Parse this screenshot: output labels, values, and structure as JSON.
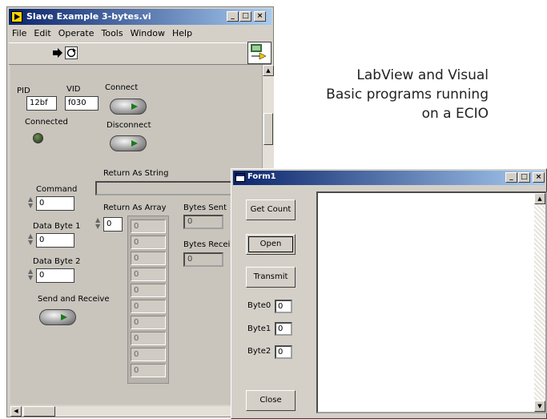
{
  "caption": {
    "line1": "LabView and Visual",
    "line2": "Basic programs running",
    "line3": "on a ECIO"
  },
  "labview": {
    "title": "Slave Example 3-bytes.vi",
    "window_buttons": [
      "_",
      "□",
      "×"
    ],
    "menu": [
      "File",
      "Edit",
      "Operate",
      "Tools",
      "Window",
      "Help"
    ],
    "pid_label": "PID",
    "pid_value": "12bf",
    "vid_label": "VID",
    "vid_value": "f030",
    "connect_label": "Connect",
    "connected_label": "Connected",
    "disconnect_label": "Disconnect",
    "return_string_label": "Return As String",
    "command_label": "Command",
    "command_value": "0",
    "data_byte1_label": "Data Byte 1",
    "data_byte1_value": "0",
    "data_byte2_label": "Data Byte 2",
    "data_byte2_value": "0",
    "return_array_label": "Return As Array",
    "array_index": "0",
    "array_values": [
      "0",
      "0",
      "0",
      "0",
      "0",
      "0",
      "0",
      "0",
      "0",
      "0"
    ],
    "bytes_sent_label": "Bytes Sent",
    "bytes_sent_value": "0",
    "bytes_received_label": "Bytes Receive",
    "bytes_received_value": "0",
    "send_receive_label": "Send and Receive"
  },
  "vbform": {
    "title": "Form1",
    "window_buttons": [
      "_",
      "□",
      "×"
    ],
    "get_count_label": "Get Count",
    "open_label": "Open",
    "transmit_label": "Transmit",
    "byte0_label": "Byte0",
    "byte0_value": "0",
    "byte1_label": "Byte1",
    "byte1_value": "0",
    "byte2_label": "Byte2",
    "byte2_value": "0",
    "close_label": "Close"
  }
}
